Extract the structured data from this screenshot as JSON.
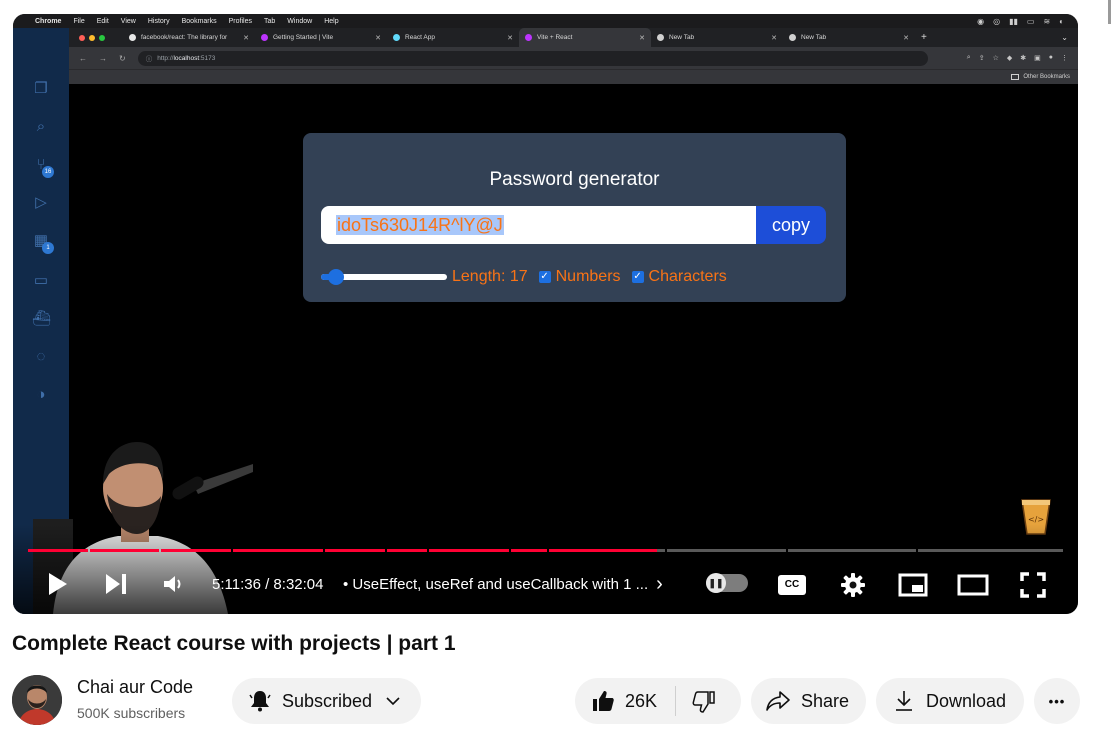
{
  "menubar": {
    "apple": "",
    "app": "Chrome",
    "items": [
      "File",
      "Edit",
      "View",
      "History",
      "Bookmarks",
      "Profiles",
      "Tab",
      "Window",
      "Help"
    ]
  },
  "browser": {
    "tabs": [
      {
        "title": "facebook/react: The library for"
      },
      {
        "title": "Getting Started | Vite"
      },
      {
        "title": "React App"
      },
      {
        "title": "Vite + React"
      },
      {
        "title": "New Tab"
      },
      {
        "title": "New Tab"
      }
    ],
    "active_tab": 3,
    "url_prefix": "http://",
    "url_host": "localhost",
    "url_port": ":5173",
    "other_bookmarks": "Other Bookmarks"
  },
  "vscode": {
    "badge_source_control": "16",
    "badge_extensions": "1"
  },
  "app": {
    "title": "Password generator",
    "password": "idoTs630J14R^lY@J",
    "copy_label": "copy",
    "length_label": "Length: 17",
    "length_value": 17,
    "length_min": 6,
    "length_max": 100,
    "numbers_label": "Numbers",
    "characters_label": "Characters",
    "numbers_checked": true,
    "characters_checked": true
  },
  "player": {
    "time_current": "5:11:36",
    "time_total": "8:32:04",
    "time_display": "5:11:36 / 8:32:04",
    "chapter": "•  UseEffect, useRef and useCallback with 1 ...",
    "chapter_chevron": "›",
    "progress_fraction": 0.608,
    "cc_label": "CC",
    "accent": "#ff0033"
  },
  "video": {
    "title": "Complete React course with projects | part 1",
    "channel": "Chai aur Code",
    "subscribers": "500K subscribers",
    "subscribed_label": "Subscribed",
    "likes": "26K",
    "share_label": "Share",
    "download_label": "Download",
    "more_label": "•••"
  }
}
